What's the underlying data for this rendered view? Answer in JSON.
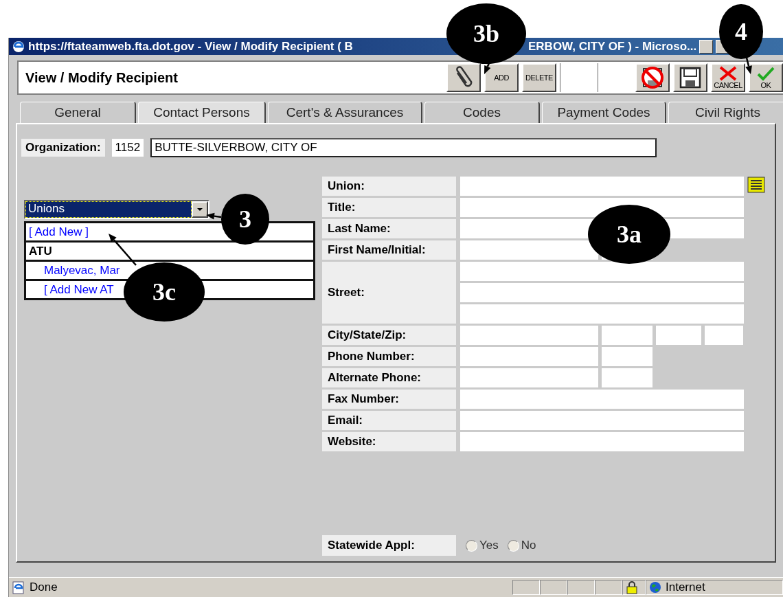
{
  "window": {
    "title_parts": [
      "https://ftateamweb.fta.dot.gov - View / Modify Recipient ( B",
      "ERBOW, CITY OF ) - Microso..."
    ]
  },
  "header": {
    "title": "View / Modify Recipient",
    "buttons": [
      {
        "kind": "attach"
      },
      {
        "kind": "text",
        "label": "ADD"
      },
      {
        "kind": "text",
        "label": "DELETE"
      },
      {
        "kind": "blank"
      },
      {
        "kind": "blank"
      },
      {
        "kind": "discard"
      },
      {
        "kind": "save"
      },
      {
        "kind": "cancel",
        "label": "CANCEL"
      },
      {
        "kind": "ok",
        "label": "OK"
      }
    ]
  },
  "tabs": [
    {
      "label": "General",
      "selected": false
    },
    {
      "label": "Contact Persons",
      "selected": true
    },
    {
      "label": "Cert's & Assurances",
      "selected": false
    },
    {
      "label": "Codes",
      "selected": false
    },
    {
      "label": "Payment Codes",
      "selected": false
    },
    {
      "label": "Civil Rights",
      "selected": false
    }
  ],
  "organization": {
    "label": "Organization:",
    "id": "1152",
    "name": "BUTTE-SILVERBOW, CITY OF"
  },
  "contact_list": {
    "dropdown": "Unions",
    "items": [
      {
        "kind": "link",
        "text": "[ Add New ]"
      },
      {
        "kind": "group",
        "text": "ATU",
        "children": [
          {
            "kind": "link",
            "text": "Malyevac, Mar"
          },
          {
            "kind": "link",
            "text": "[ Add New AT"
          }
        ]
      }
    ]
  },
  "form": {
    "rows": [
      {
        "label": "Union:",
        "kind": "lookup"
      },
      {
        "label": "Title:",
        "kind": "full"
      },
      {
        "label": "Last Name:",
        "kind": "full"
      },
      {
        "label": "First Name/Initial:",
        "kind": "name_initial"
      },
      {
        "label": "Street:",
        "kind": "street"
      },
      {
        "label": "City/State/Zip:",
        "kind": "city_state_zip"
      },
      {
        "label": "Phone Number:",
        "kind": "phone_ext"
      },
      {
        "label": "Alternate Phone:",
        "kind": "phone_ext"
      },
      {
        "label": "Fax Number:",
        "kind": "full"
      },
      {
        "label": "Email:",
        "kind": "full"
      },
      {
        "label": "Website:",
        "kind": "full"
      }
    ],
    "statewide": {
      "label": "Statewide Appl:",
      "options": [
        {
          "label": "Yes",
          "selected": false
        },
        {
          "label": "No",
          "selected": false
        }
      ]
    }
  },
  "status_bar": {
    "text": "Done",
    "zone": "Internet"
  },
  "callouts": [
    {
      "label": "3b"
    },
    {
      "label": "4"
    },
    {
      "label": "3"
    },
    {
      "label": "3a"
    },
    {
      "label": "3c"
    }
  ]
}
